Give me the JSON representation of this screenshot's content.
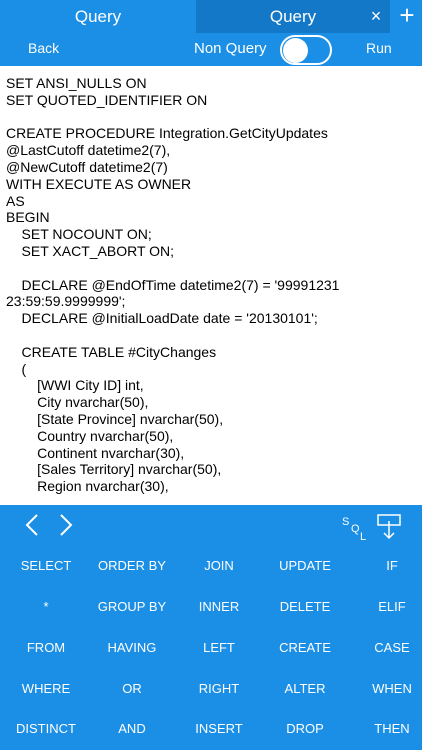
{
  "tabs": [
    {
      "label": "Query",
      "active": false
    },
    {
      "label": "Query",
      "active": true
    }
  ],
  "tab_close_glyph": "×",
  "tab_add_glyph": "+",
  "toolbar": {
    "back_label": "Back",
    "non_query_label": "Non Query",
    "toggle_on": false,
    "run_label": "Run"
  },
  "editor_text": "SET ANSI_NULLS ON\nSET QUOTED_IDENTIFIER ON\n\nCREATE PROCEDURE Integration.GetCityUpdates\n@LastCutoff datetime2(7),\n@NewCutoff datetime2(7)\nWITH EXECUTE AS OWNER\nAS\nBEGIN\n    SET NOCOUNT ON;\n    SET XACT_ABORT ON;\n\n    DECLARE @EndOfTime datetime2(7) = '99991231\n23:59:59.9999999';\n    DECLARE @InitialLoadDate date = '20130101';\n\n    CREATE TABLE #CityChanges\n    (\n        [WWI City ID] int,\n        City nvarchar(50),\n        [State Province] nvarchar(50),\n        Country nvarchar(50),\n        Continent nvarchar(30),\n        [Sales Territory] nvarchar(50),\n        Region nvarchar(30),",
  "icons": {
    "left": "chevron-left-icon",
    "right": "chevron-right-icon",
    "sql": "sql-icon",
    "insert": "insert-icon"
  },
  "keypad": [
    [
      "SELECT",
      "ORDER BY",
      "JOIN",
      "UPDATE",
      "IF"
    ],
    [
      "*",
      "GROUP BY",
      "INNER",
      "DELETE",
      "ELIF"
    ],
    [
      "FROM",
      "HAVING",
      "LEFT",
      "CREATE",
      "CASE"
    ],
    [
      "WHERE",
      "OR",
      "RIGHT",
      "ALTER",
      "WHEN"
    ],
    [
      "DISTINCT",
      "AND",
      "INSERT",
      "DROP",
      "THEN"
    ]
  ],
  "colors": {
    "accent": "#1b8fe6",
    "active_tab": "#1478c8",
    "text": "#000000",
    "keypad_text": "#ffffff"
  }
}
